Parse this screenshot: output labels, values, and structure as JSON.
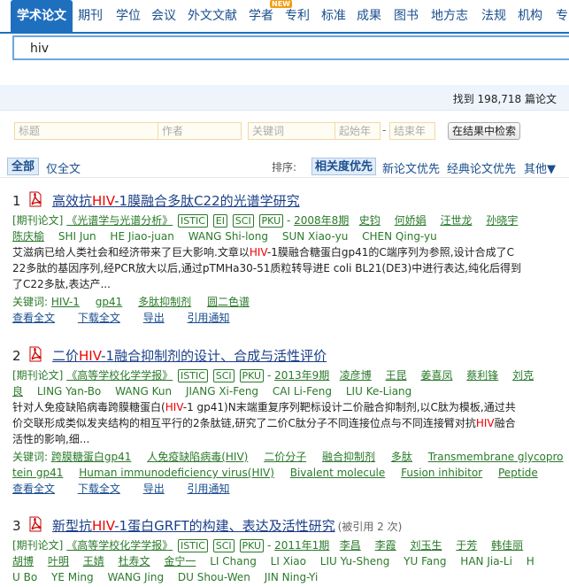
{
  "nav": {
    "active": "学术论文",
    "tabs": [
      "期刊",
      "学位",
      "会议",
      "外文文献",
      "学者",
      "专利",
      "标准",
      "成果",
      "图书",
      "地方志",
      "法规",
      "机构",
      "专"
    ],
    "new_badge": "NEW"
  },
  "search": {
    "value": "hiv",
    "placeholder": ""
  },
  "result_count": "找到 198,718 篇论文",
  "filter": {
    "title_ph": "标题",
    "author_ph": "作者",
    "keyword_ph": "关键词",
    "start_year_ph": "起始年",
    "end_year_ph": "结束年",
    "search_button": "在结果中检索",
    "dash": "-"
  },
  "scope": {
    "all": "全部",
    "fulltext": "仅全文"
  },
  "sort": {
    "label": "排序:",
    "selected": "相关度优先",
    "options": [
      "新论文优先",
      "经典论文优先",
      "其他▼"
    ]
  },
  "results": [
    {
      "num": "1",
      "title_pre": "高效抗",
      "title_hl": "HIV",
      "title_post": "-1膜融合多肽C22的光谱学研究",
      "type": "[期刊论文]",
      "journal": "《光谱学与光谱分析》",
      "badges": [
        "ISTIC",
        "EI",
        "SCI",
        "PKU"
      ],
      "date": "2008年8期",
      "authors_cn": [
        "史钧",
        "何娇娟",
        "汪世龙",
        "孙晓宇"
      ],
      "authors_line2": [
        "陈庆榆",
        "SHI Jun",
        "HE Jiao-juan",
        "WANG Shi-long",
        "SUN Xiao-yu",
        "CHEN Qing-yu"
      ],
      "abstract_l1_pre": "艾滋病已给人类社会和经济带来了巨大影响.文章以",
      "abstract_l1_hl": "HIV",
      "abstract_l1_post": "-1膜融合糖蛋白gp41的C端序列为参照,设计合成了C",
      "abstract_l2": "22多肽的基因序列,经PCR放大以后,通过pTMHa30-51质粒转导进E coli BL21(DE3)中进行表达,纯化后得到",
      "abstract_l3": "了C22多肽,表达产...",
      "kw_label": "关键词:",
      "keywords": [
        "HIV-1",
        "gp41",
        "多肽抑制剂",
        "圆二色谱"
      ],
      "actions": [
        "查看全文",
        "下载全文",
        "导出",
        "引用通知"
      ]
    },
    {
      "num": "2",
      "title_pre": "二价",
      "title_hl": "HIV",
      "title_post": "-1融合抑制剂的设计、合成与活性评价",
      "type": "[期刊论文]",
      "journal": "《高等学校化学学报》",
      "badges": [
        "ISTIC",
        "SCI",
        "PKU"
      ],
      "date": "2013年9期",
      "authors_cn": [
        "凌彦博",
        "王昆",
        "姜喜凤",
        "蔡利锋",
        "刘克"
      ],
      "authors_line2_prefix": "良",
      "authors_line2": [
        "LING Yan-Bo",
        "WANG Kun",
        "JIANG Xi-Feng",
        "CAI Li-Feng",
        "LIU Ke-Liang"
      ],
      "abstract_l1_pre": "针对人免疫缺陷病毒跨膜糖蛋白(",
      "abstract_l1_hl": "HIV",
      "abstract_l1_post": "-1 gp41)N末端重复序列靶标设计二价融合抑制剂,以C肽为模板,通过共",
      "abstract_l2_pre": "价交联形成类似发夹结构的相互平行的2条肽链,研究了二价C肽分子不同连接位点与不同连接臂对抗",
      "abstract_l2_hl": "HIV",
      "abstract_l2_post": "融合",
      "abstract_l3": "活性的影响,细...",
      "kw_label": "关键词:",
      "keywords": [
        "跨膜糖蛋白gp41",
        "人免疫缺陷病毒(HIV)",
        "二价分子",
        "融合抑制剂",
        "多肽",
        "Transmembrane glycopro"
      ],
      "keywords_l2": [
        "tein gp41",
        "Human immunodeficiency virus(HIV)",
        "Bivalent molecule",
        "Fusion inhibitor",
        "Peptide"
      ],
      "actions": [
        "查看全文",
        "下载全文",
        "导出",
        "引用通知"
      ]
    },
    {
      "num": "3",
      "title_pre": "新型抗",
      "title_hl": "HIV",
      "title_post": "-1蛋白GRFT的构建、表达及活性研究",
      "cited": "(被引用 2 次)",
      "type": "[期刊论文]",
      "journal": "《高等学校化学学报》",
      "badges": [
        "ISTIC",
        "SCI",
        "PKU"
      ],
      "date": "2011年1期",
      "authors_cn": [
        "李昌",
        "李霞",
        "刘玉生",
        "于芳",
        "韩佳丽"
      ],
      "authors_line2": [
        "胡博",
        "叶明",
        "王婧",
        "杜寿文",
        "金宁一",
        "LI Chang",
        "LI Xiao",
        "LIU Yu-Sheng",
        "YU Fang",
        "HAN Jia-Li",
        "H"
      ],
      "authors_line3": [
        "U Bo",
        "YE Ming",
        "WANG Jing",
        "DU Shou-Wen",
        "JIN Ning-Yi"
      ]
    }
  ],
  "colors": {
    "brand_blue": "#1f6fbf",
    "link_blue": "#1a3f88",
    "green": "#2a7a2a",
    "highlight_red": "#e00000",
    "pdf_red": "#cc0000"
  }
}
